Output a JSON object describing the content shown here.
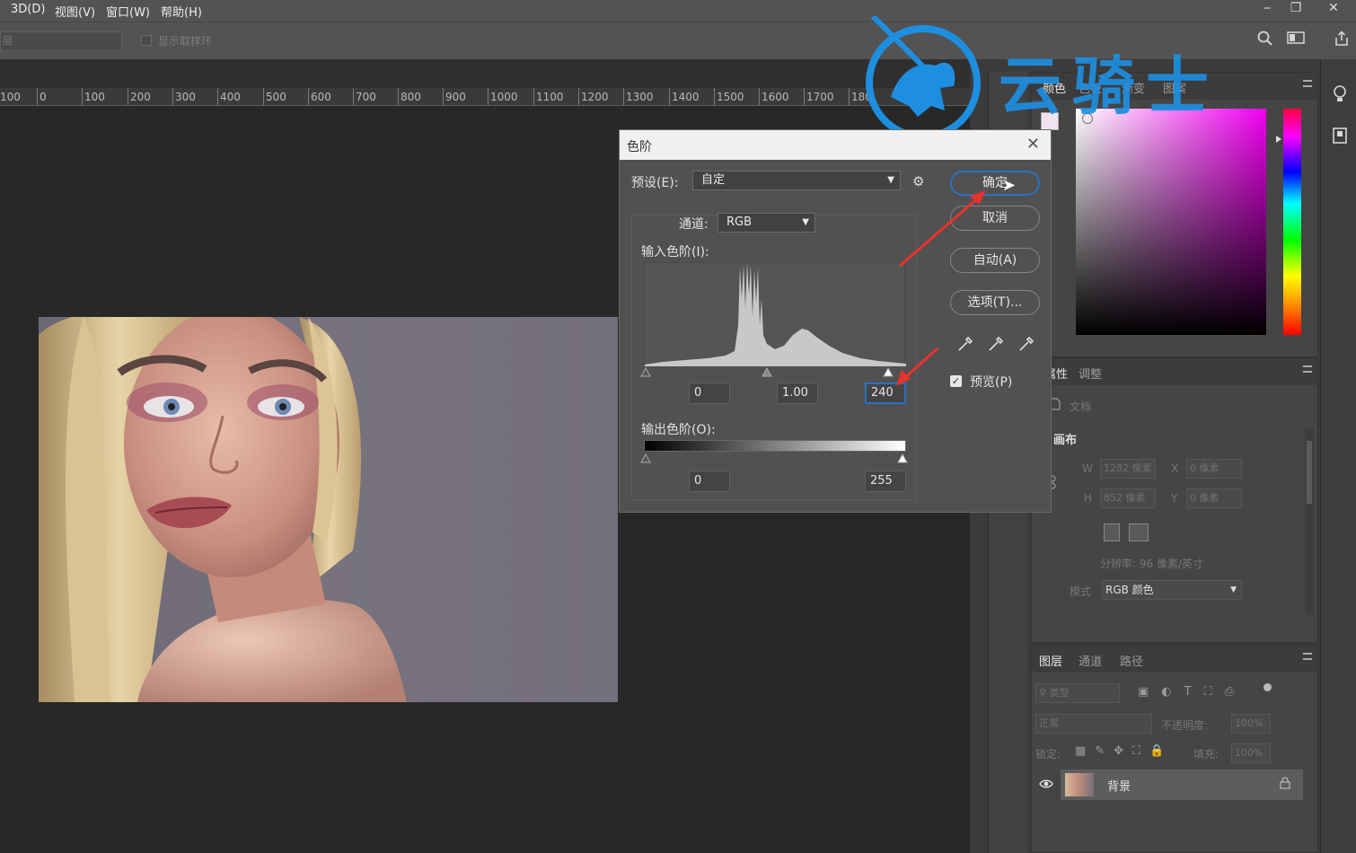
{
  "menubar": {
    "items": [
      "3D(D)",
      "视图(V)",
      "窗口(W)",
      "帮助(H)"
    ],
    "window_buttons": [
      "‒",
      "❐",
      "✕"
    ]
  },
  "options": {
    "layer_select": "层",
    "sample_ring_label": "显示取样环"
  },
  "ruler": {
    "ticks": [
      "100",
      "0",
      "100",
      "200",
      "300",
      "400",
      "500",
      "600",
      "700",
      "800",
      "900",
      "1000",
      "1100",
      "1200",
      "1300",
      "1400",
      "1500",
      "1600",
      "1700",
      "180"
    ]
  },
  "watermark": {
    "text": "云骑士"
  },
  "color_panel": {
    "tabs": [
      "颜色",
      "色板",
      "渐变",
      "图案"
    ]
  },
  "props_panel": {
    "tabs": [
      "属性",
      "调整"
    ],
    "doc_label": "文档",
    "canvas_title": "画布",
    "w_label": "W",
    "w_value": "1282 像素",
    "h_label": "H",
    "h_value": "852 像素",
    "x_label": "X",
    "x_value": "0 像素",
    "y_label": "Y",
    "y_value": "0 像素",
    "resolution": "分辨率: 96 像素/英寸",
    "mode_label": "模式",
    "mode_value": "RGB 颜色"
  },
  "layers_panel": {
    "tabs": [
      "图层",
      "通道",
      "路径"
    ],
    "filter_placeholder": "类型",
    "blend_mode": "正常",
    "opacity_label": "不透明度:",
    "opacity_value": "100%",
    "lock_label": "锁定:",
    "fill_label": "填充:",
    "fill_value": "100%",
    "layer_name": "背景"
  },
  "levels_dialog": {
    "title": "色阶",
    "preset_label": "预设(E):",
    "preset_value": "自定",
    "channel_label": "通道:",
    "channel_value": "RGB",
    "input_label": "输入色阶(I):",
    "input_black": "0",
    "input_gamma": "1.00",
    "input_white": "240",
    "output_label": "输出色阶(O):",
    "output_black": "0",
    "output_white": "255",
    "ok_button": "确定",
    "cancel_button": "取消",
    "auto_button": "自动(A)",
    "options_button": "选项(T)...",
    "preview_label": "预览(P)",
    "preview_checked": true
  },
  "colors": {
    "accent": "#2d70c2",
    "annotation": "#e8322e",
    "watermark": "#1e8fe0"
  }
}
